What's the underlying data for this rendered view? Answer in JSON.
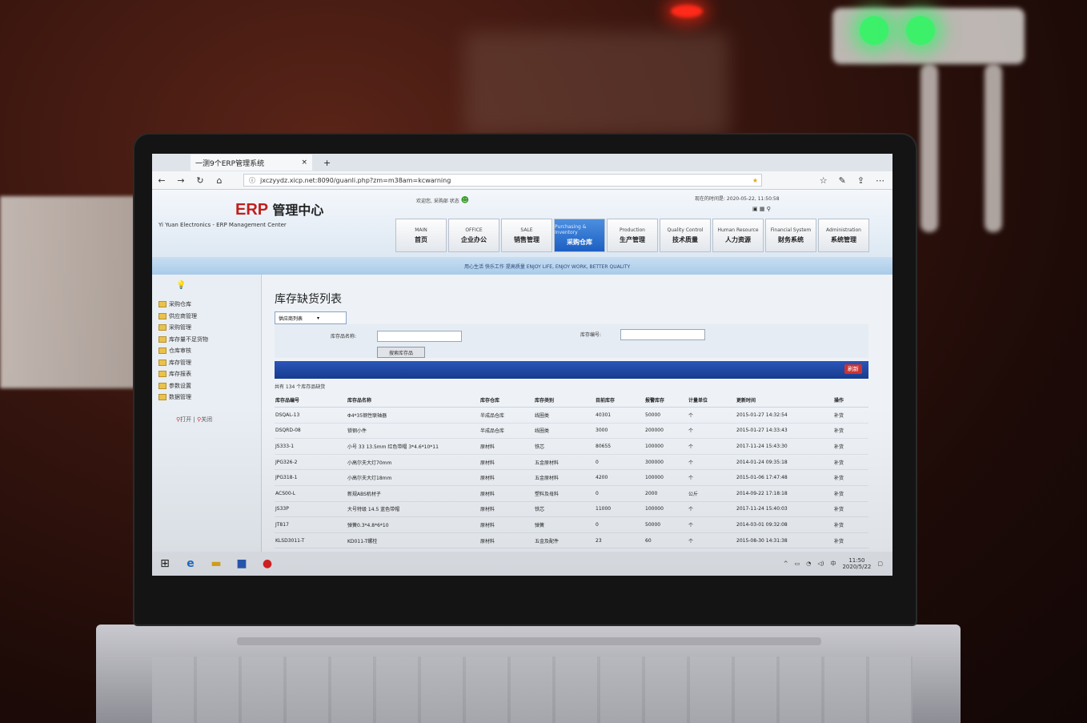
{
  "browser": {
    "tab_title": "一测9个ERP管理系统",
    "url": "jxczyydz.xicp.net:8090/guanli.php?zm=m38am=kcwarning",
    "tab_close": "×",
    "tab_add": "+"
  },
  "erp": {
    "logo_erp": "ERP",
    "logo_text": "管理中心",
    "subtitle": "Yi Yuan Electronics - ERP Management Center",
    "greeting": "欢迎您, 采购部 状态",
    "last_login": "现在的时间是: 2020-05-22, 11:50:58",
    "slogan": "用心生活 快乐工作 提高质量 ENJOY LIFE, ENJOY WORK, BETTER QUALITY",
    "menu": [
      {
        "en": "MAIN",
        "cn": "首页"
      },
      {
        "en": "OFFICE",
        "cn": "企业办公"
      },
      {
        "en": "SALE",
        "cn": "销售管理"
      },
      {
        "en": "Purchasing & Inventory",
        "cn": "采购仓库"
      },
      {
        "en": "Production",
        "cn": "生产管理"
      },
      {
        "en": "Quality Control",
        "cn": "技术质量"
      },
      {
        "en": "Human Resource",
        "cn": "人力资源"
      },
      {
        "en": "Financial System",
        "cn": "财务系统"
      },
      {
        "en": "Administration",
        "cn": "系统管理"
      }
    ],
    "sidebar": {
      "root": "采购仓库",
      "items": [
        "供应商管理",
        "采购管理",
        "库存量不足货物",
        "仓库审核",
        "库存管理",
        "库存报表",
        "参数设置",
        "数据管理"
      ],
      "open_label": "打开",
      "close_label": "关闭"
    }
  },
  "main": {
    "page_title": "库存缺货列表",
    "dropdown_value": "供应商列表",
    "search_name_label": "库存品名称:",
    "search_code_label": "库存编号:",
    "search_button": "搜索库存品",
    "bar_button": "刷新",
    "count_text": "共有 134 个库存品缺货",
    "columns": [
      "库存品编号",
      "库存品名称",
      "库存仓库",
      "库存类别",
      "目前库存",
      "报警库存",
      "计量单位",
      "更新时间",
      "操作"
    ],
    "rows": [
      [
        "DSQAL-13",
        "Φ4*35钢性联轴器",
        "半成品仓库",
        "线圈类",
        "40301",
        "50000",
        "个",
        "2015-01-27 14:32:54",
        "补货"
      ],
      [
        "DSQRD-08",
        "锁钢小件",
        "半成品仓库",
        "线圈类",
        "3000",
        "200000",
        "个",
        "2015-01-27 14:33:43",
        "补货"
      ],
      [
        "JS333-1",
        "小号 33 13.5mm 红色带帽 3*4.6*10*11",
        "原材料",
        "铁芯",
        "80655",
        "100000",
        "个",
        "2017-11-24 15:43:30",
        "补货"
      ],
      [
        "JPG326-2",
        "小高尔夫大灯70mm",
        "原材料",
        "五金原材料",
        "0",
        "300000",
        "个",
        "2014-01-24 09:35:18",
        "补货"
      ],
      [
        "JPG318-1",
        "小高尔夫大灯18mm",
        "原材料",
        "五金原材料",
        "4200",
        "100000",
        "个",
        "2015-01-06 17:47:48",
        "补货"
      ],
      [
        "ACS00-L",
        "新规ABS机材子",
        "原材料",
        "塑料及母料",
        "0",
        "2000",
        "公斤",
        "2014-09-22 17:18:18",
        "补货"
      ],
      [
        "JS33P",
        "大号特级 14.5 蓝色带帽",
        "原材料",
        "铁芯",
        "11000",
        "100000",
        "个",
        "2017-11-24 15:40:03",
        "补货"
      ],
      [
        "JT817",
        "弹簧0.3*4.8*6*10",
        "原材料",
        "弹簧",
        "0",
        "50000",
        "个",
        "2014-03-01 09:32:08",
        "补货"
      ],
      [
        "KLSD3011-T",
        "KD011-T螺栓",
        "原材料",
        "五金及配件",
        "23",
        "60",
        "个",
        "2015-08-30 14:31:38",
        "补货"
      ]
    ]
  },
  "taskbar": {
    "time": "11:50",
    "date": "2020/5/22",
    "ime": "中"
  },
  "colors": {
    "logo_red": "#c0201c",
    "active_menu": "#2a6fd0",
    "blue_bar": "#1f47a3"
  }
}
